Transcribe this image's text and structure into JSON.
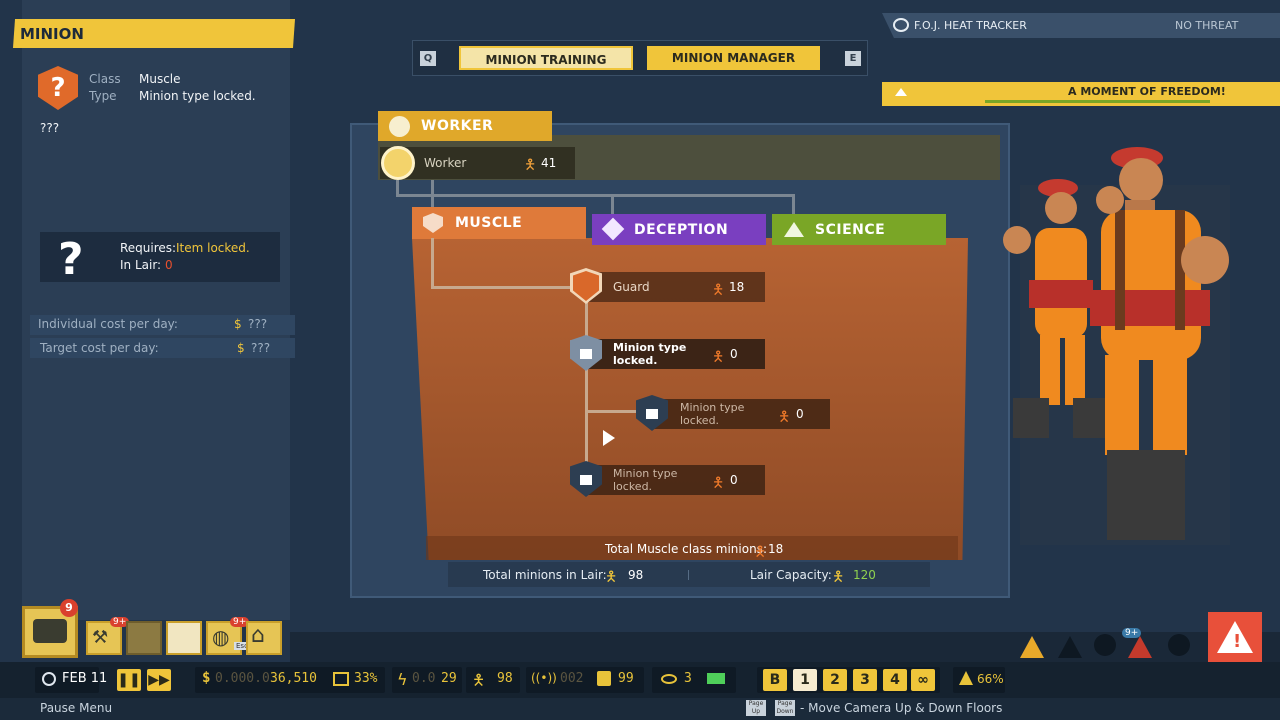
{
  "minion_panel": {
    "title": "MINION",
    "class_label": "Class",
    "class_value": "Muscle",
    "type_label": "Type",
    "type_value": "Minion type locked.",
    "unknown": "???",
    "requires_label": "Requires:",
    "requires_value": "Item locked.",
    "in_lair_label": "In Lair:",
    "in_lair_value": "0",
    "individual_cost_label": "Individual cost per day:",
    "individual_cost_value": "???",
    "target_cost_label": "Target cost per day:",
    "target_cost_value": "???",
    "currency": "$"
  },
  "tabs": {
    "key_left": "Q",
    "key_right": "E",
    "training": "MINION TRAINING",
    "manager": "MINION MANAGER"
  },
  "heat": {
    "title": "F.O.J. HEAT TRACKER",
    "status": "NO THREAT",
    "banner": "A MOMENT OF FREEDOM!"
  },
  "tree": {
    "worker_tab": "WORKER",
    "worker_name": "Worker",
    "worker_count": "41",
    "muscle_tab": "MUSCLE",
    "deception_tab": "DECEPTION",
    "science_tab": "SCIENCE",
    "guard_name": "Guard",
    "guard_count": "18",
    "locked_1": "Minion type locked.",
    "locked_1_count": "0",
    "locked_2": "Minion type locked.",
    "locked_2_count": "0",
    "locked_3": "Minion type locked.",
    "locked_3_count": "0",
    "total_class_label": "Total Muscle class minions:",
    "total_class_value": "18",
    "total_lair_label": "Total minions in Lair:",
    "total_lair_value": "98",
    "capacity_label": "Lair Capacity:",
    "capacity_value": "120"
  },
  "hud": {
    "date": "FEB 11",
    "money_dim": "0.000.0",
    "money": "36,510",
    "money_pct": "33%",
    "power_dim": "0.0",
    "power": "29",
    "minions": "98",
    "signal_dim": "002",
    "signal": "99",
    "eye": "3",
    "floor_b": "B",
    "floor_1": "1",
    "floor_2": "2",
    "floor_3": "3",
    "floor_4": "4",
    "science_pct": "66%",
    "dock_badge": "9",
    "dock_badge_small_1": "9+",
    "dock_badge_small_2": "9+",
    "alert_badge": "9+",
    "esc_key": "Esc",
    "pause_menu": "Pause Menu",
    "page_up": "Page Up",
    "page_down": "Page Down",
    "camera_hint": "- Move Camera Up & Down Floors"
  },
  "colors": {
    "accent_yellow": "#f0c53a",
    "muscle_orange": "#df7a3a",
    "deception_purple": "#7a3fc0",
    "science_green": "#7aa626",
    "money_yellow": "#e8c33a",
    "capacity_green": "#8fd14f"
  }
}
